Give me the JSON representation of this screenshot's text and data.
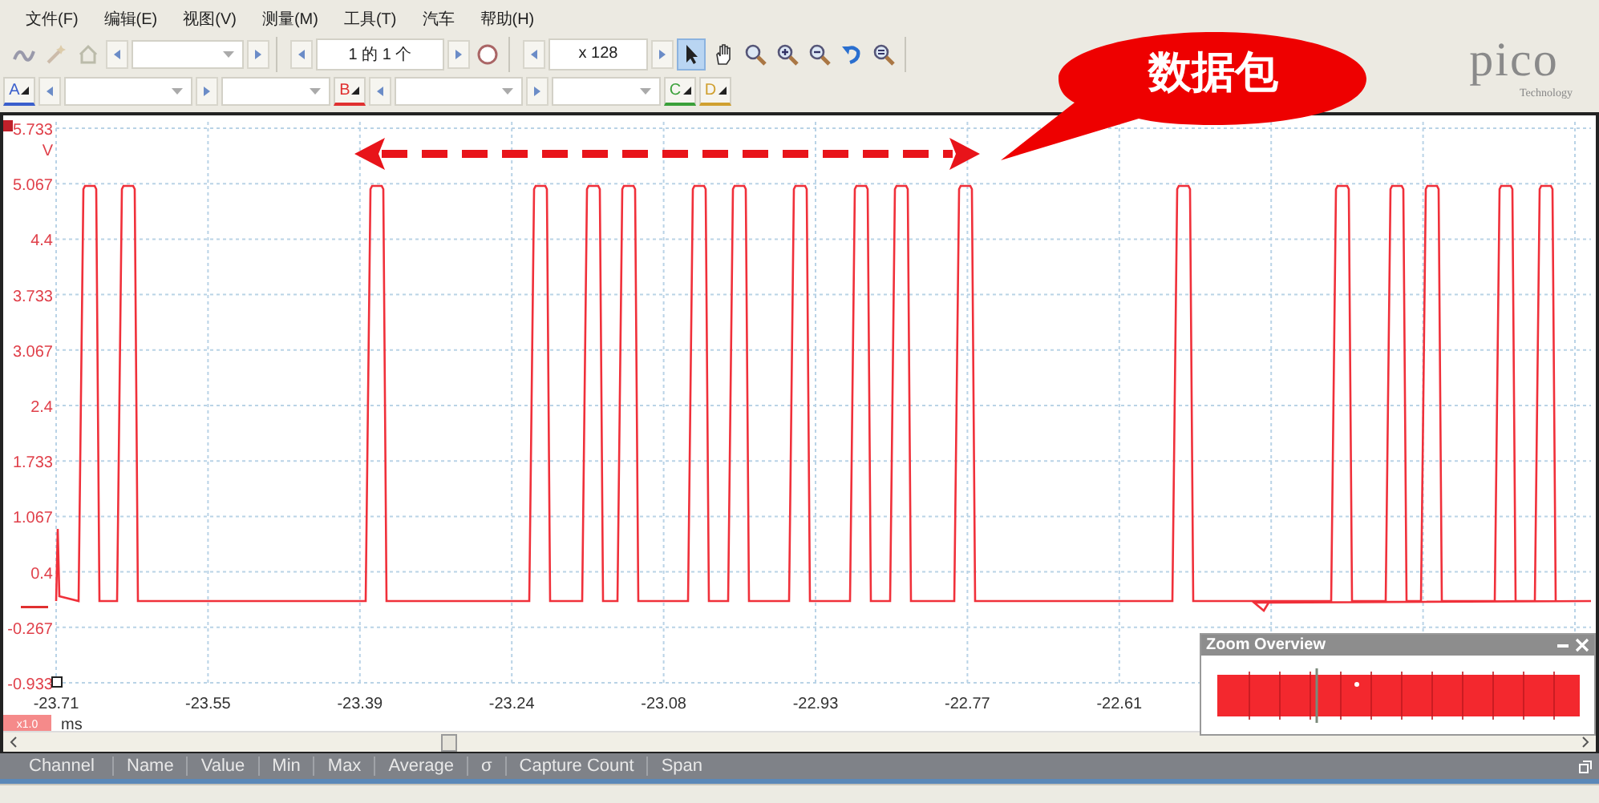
{
  "menu": [
    "文件(F)",
    "编辑(E)",
    "视图(V)",
    "测量(M)",
    "工具(T)",
    "汽车",
    "帮助(H)"
  ],
  "toolbar": {
    "page_indicator": "1 的 1 个",
    "zoom_factor": "x 128",
    "tools": [
      {
        "kind": "pointer",
        "selected": true
      },
      {
        "kind": "hand",
        "selected": false
      },
      {
        "kind": "zoom",
        "selected": false
      },
      {
        "kind": "zoom-in",
        "selected": false
      },
      {
        "kind": "zoom-out",
        "selected": false
      },
      {
        "kind": "undo",
        "selected": false
      },
      {
        "kind": "zoom-fit",
        "selected": false
      }
    ]
  },
  "channels": [
    {
      "label": "A",
      "color": "#3a5fcd"
    },
    {
      "label": "B",
      "color": "#e03030"
    },
    {
      "label": "C",
      "color": "#3aa03a"
    },
    {
      "label": "D",
      "color": "#d0a030"
    }
  ],
  "logo": {
    "name": "pico",
    "tagline": "Technology"
  },
  "callout": {
    "text": "数据包"
  },
  "chart": {
    "y_unit": "V",
    "y_labels": [
      "5.733",
      "5.067",
      "4.4",
      "3.733",
      "3.067",
      "2.4",
      "1.733",
      "1.067",
      "0.4",
      "-0.267",
      "-0.933"
    ],
    "x_labels": [
      "-23.71",
      "-23.55",
      "-23.39",
      "-23.24",
      "-23.08",
      "-22.93",
      "-22.77",
      "-22.61"
    ],
    "x_multiplier": "x1.0",
    "x_unit": "ms"
  },
  "zoom_overview": {
    "title": "Zoom Overview"
  },
  "measurement_columns": [
    "Channel",
    "Name",
    "Value",
    "Min",
    "Max",
    "Average",
    "σ",
    "Capture Count",
    "Span"
  ]
}
